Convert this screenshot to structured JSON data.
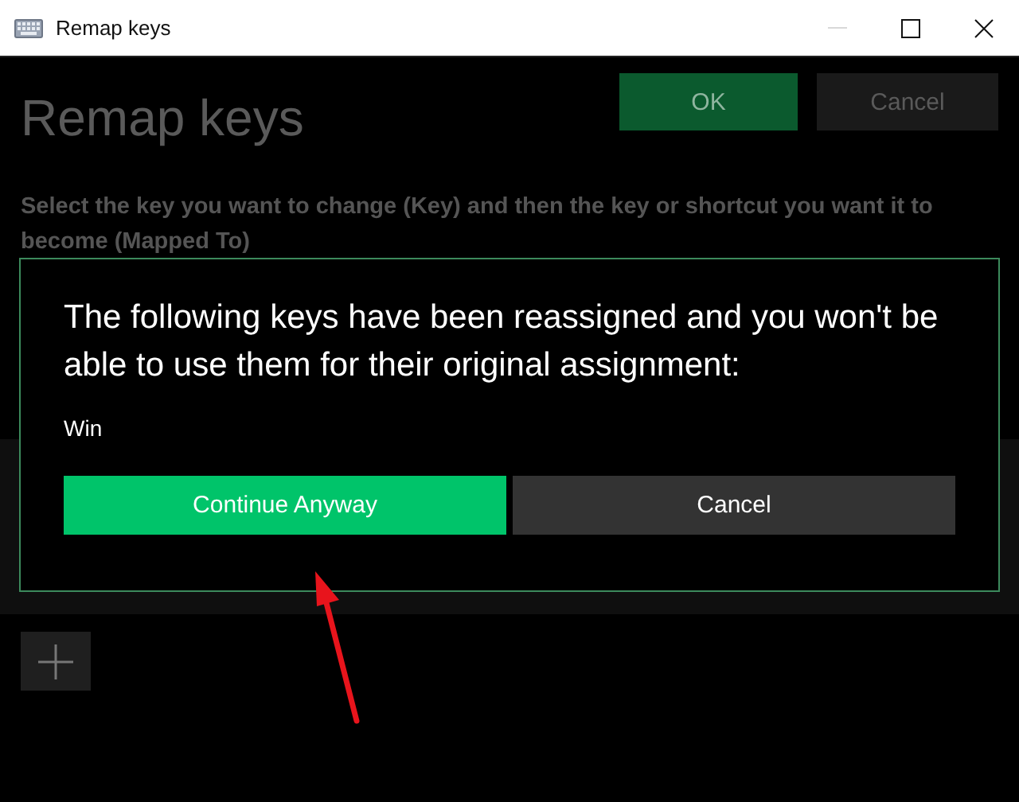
{
  "window": {
    "title": "Remap keys"
  },
  "heading": "Remap keys",
  "header_buttons": [
    {
      "label": "OK",
      "kind": "primary"
    },
    {
      "label": "Cancel",
      "kind": "secondary"
    }
  ],
  "instruction": "Select the key you want to change (Key) and then the key or shortcut you want it to become (Mapped To)",
  "dialog": {
    "message": "The following keys have been reassigned and you won't be able to use them for their original assignment:",
    "keys": [
      "Win"
    ],
    "buttons": [
      {
        "label": "Continue Anyway",
        "kind": "primary"
      },
      {
        "label": "Cancel",
        "kind": "secondary"
      }
    ]
  }
}
